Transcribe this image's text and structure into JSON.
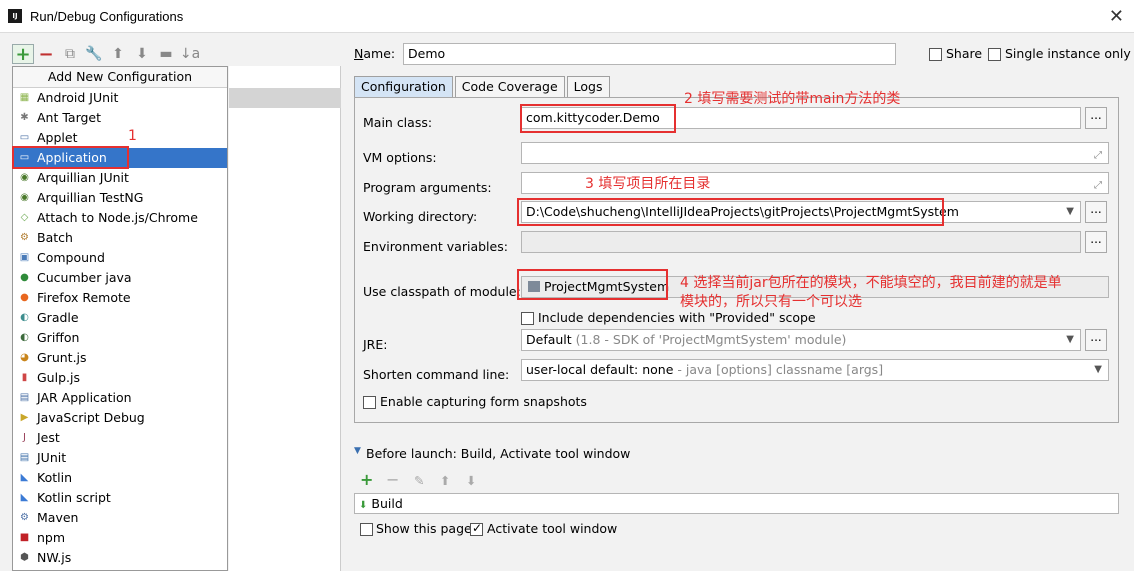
{
  "window": {
    "title": "Run/Debug Configurations",
    "close": "✕"
  },
  "toolbar": {
    "add": "+",
    "remove": "−",
    "copy": "⧉",
    "edit_defaults": "🔧",
    "move_up": "⬆",
    "move_down": "⬇",
    "folder": "▬",
    "sort": "↓a"
  },
  "left_panel": {
    "header": "Add New Configuration",
    "items": [
      {
        "label": "Android JUnit",
        "icon": "android-icon"
      },
      {
        "label": "Ant Target",
        "icon": "ant-icon"
      },
      {
        "label": "Applet",
        "icon": "applet-icon"
      },
      {
        "label": "Application",
        "icon": "application-icon"
      },
      {
        "label": "Arquillian JUnit",
        "icon": "arquillian-icon"
      },
      {
        "label": "Arquillian TestNG",
        "icon": "arquillian-icon"
      },
      {
        "label": "Attach to Node.js/Chrome",
        "icon": "node-icon"
      },
      {
        "label": "Batch",
        "icon": "batch-icon"
      },
      {
        "label": "Compound",
        "icon": "compound-icon"
      },
      {
        "label": "Cucumber java",
        "icon": "cucumber-icon"
      },
      {
        "label": "Firefox Remote",
        "icon": "firefox-icon"
      },
      {
        "label": "Gradle",
        "icon": "gradle-icon"
      },
      {
        "label": "Griffon",
        "icon": "griffon-icon"
      },
      {
        "label": "Grunt.js",
        "icon": "grunt-icon"
      },
      {
        "label": "Gulp.js",
        "icon": "gulp-icon"
      },
      {
        "label": "JAR Application",
        "icon": "jar-icon"
      },
      {
        "label": "JavaScript Debug",
        "icon": "jsdebug-icon"
      },
      {
        "label": "Jest",
        "icon": "jest-icon"
      },
      {
        "label": "JUnit",
        "icon": "junit-icon"
      },
      {
        "label": "Kotlin",
        "icon": "kotlin-icon"
      },
      {
        "label": "Kotlin script",
        "icon": "kotlin-icon"
      },
      {
        "label": "Maven",
        "icon": "maven-icon"
      },
      {
        "label": "npm",
        "icon": "npm-icon"
      },
      {
        "label": "NW.js",
        "icon": "nwjs-icon"
      }
    ],
    "selected_index": 3
  },
  "name_label": "Name:",
  "name_value": "Demo",
  "share_label": "Share",
  "single_instance_label": "Single instance only",
  "tabs": [
    "Configuration",
    "Code Coverage",
    "Logs"
  ],
  "form": {
    "main_class_label": "Main class:",
    "main_class_value": "com.kittycoder.Demo",
    "vm_options_label": "VM options:",
    "program_args_label": "Program arguments:",
    "working_dir_label": "Working directory:",
    "working_dir_value": "D:\\Code\\shucheng\\IntelliJIdeaProjects\\gitProjects\\ProjectMgmtSystem",
    "env_vars_label": "Environment variables:",
    "classpath_label": "Use classpath of module:",
    "classpath_value": "ProjectMgmtSystem",
    "include_deps_label": "Include dependencies with \"Provided\" scope",
    "jre_label": "JRE:",
    "jre_value": "Default",
    "jre_hint": "(1.8 - SDK of 'ProjectMgmtSystem' module)",
    "shorten_label": "Shorten command line:",
    "shorten_value": "user-local default: none",
    "shorten_hint": "- java [options] classname [args]",
    "capture_label": "Enable capturing form snapshots",
    "dots": "..."
  },
  "before_launch": {
    "title": "Before launch: Build, Activate tool window",
    "task": "Build",
    "show_page_label": "Show this page",
    "activate_label": "Activate tool window"
  },
  "annotations": {
    "a1": "1",
    "a2": "2 填写需要测试的带main方法的类",
    "a3": "3 填写项目所在目录",
    "a4_line1": "4 选择当前jar包所在的模块，不能填空的，我目前建的就是单",
    "a4_line2": "模块的，所以只有一个可以选"
  },
  "colors": {
    "annotation": "#e53030",
    "selection": "#3575c9",
    "tab_active": "#d4e4f5"
  }
}
